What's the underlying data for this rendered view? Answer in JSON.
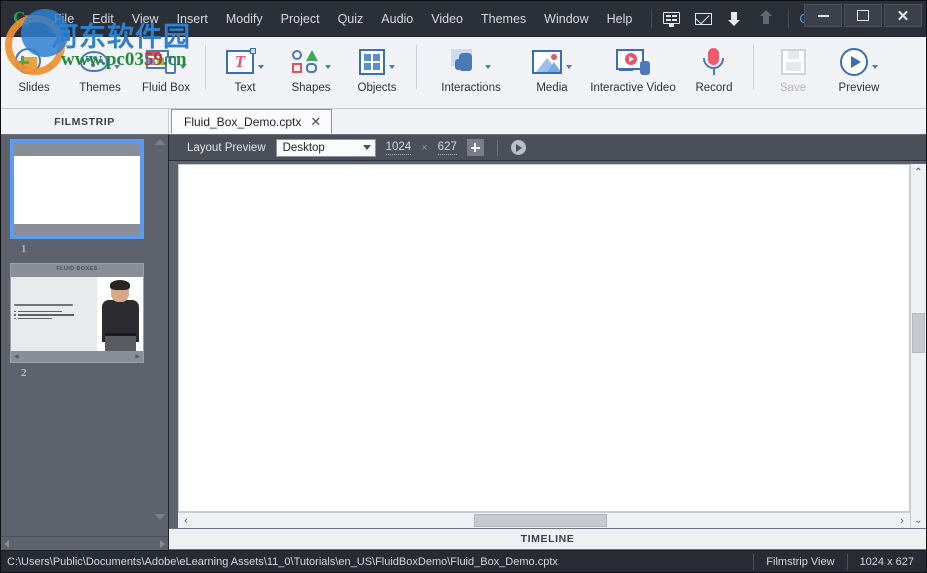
{
  "window": {
    "logo_text": "Cp",
    "workspace": "Classic",
    "controls": {
      "minimize": "–",
      "maximize": "□",
      "close": "✕"
    }
  },
  "menubar": {
    "items": [
      "File",
      "Edit",
      "View",
      "Insert",
      "Modify",
      "Project",
      "Quiz",
      "Audio",
      "Video",
      "Themes",
      "Window",
      "Help"
    ],
    "icons": [
      "monitor-icon",
      "mail-icon",
      "download-arrow-icon",
      "upload-arrow-icon"
    ]
  },
  "watermark": {
    "chinese": "河东软件园",
    "url_prefix": "www.pc03",
    "url_mid": "59",
    "url_suffix": ".cn"
  },
  "ribbon": {
    "groups": [
      {
        "items": [
          {
            "label": "Slides",
            "icon": "slides-icon",
            "caret": true,
            "disabled": false
          },
          {
            "label": "Themes",
            "icon": "themes-icon",
            "caret": true,
            "disabled": false
          },
          {
            "label": "Fluid Box",
            "icon": "fluid-box-icon",
            "caret": true,
            "disabled": false
          }
        ]
      },
      {
        "items": [
          {
            "label": "Text",
            "icon": "text-icon",
            "caret": true,
            "disabled": false
          },
          {
            "label": "Shapes",
            "icon": "shapes-icon",
            "caret": true,
            "disabled": false
          },
          {
            "label": "Objects",
            "icon": "objects-icon",
            "caret": true,
            "disabled": false
          }
        ]
      },
      {
        "items": [
          {
            "label": "Interactions",
            "icon": "interactions-icon",
            "caret": true,
            "disabled": false
          },
          {
            "label": "Media",
            "icon": "media-icon",
            "caret": true,
            "disabled": false
          },
          {
            "label": "Interactive Video",
            "icon": "interactive-video-icon",
            "caret": false,
            "disabled": false
          },
          {
            "label": "Record",
            "icon": "record-icon",
            "caret": false,
            "disabled": false
          }
        ]
      },
      {
        "items": [
          {
            "label": "Save",
            "icon": "save-icon",
            "caret": false,
            "disabled": true
          },
          {
            "label": "Preview",
            "icon": "preview-icon",
            "caret": true,
            "disabled": false
          }
        ]
      }
    ]
  },
  "tabs": {
    "filmstrip_label": "FILMSTRIP",
    "document": {
      "name": "Fluid_Box_Demo.cptx",
      "close": "✕"
    }
  },
  "filmstrip": {
    "slides": [
      {
        "number": "1",
        "selected": true,
        "title": "",
        "has_photo": false
      },
      {
        "number": "2",
        "selected": false,
        "title": "FLUID BOXES",
        "has_photo": true,
        "body_text": "Responsive authoring made easier and faster!",
        "bullets": [
          "Intelligent use of white space",
          "Device friendly content alignment",
          "Reclaim unused space"
        ]
      }
    ]
  },
  "layoutbar": {
    "label": "Layout Preview",
    "device": "Desktop",
    "width": "1024",
    "separator": "×",
    "height": "627",
    "add_button": "add-breakpoint-icon",
    "play_button": "preview-play-icon"
  },
  "timeline": {
    "label": "TIMELINE"
  },
  "statusbar": {
    "path": "C:\\Users\\Public\\Documents\\Adobe\\eLearning Assets\\11_0\\Tutorials\\en_US\\FluidBoxDemo\\Fluid_Box_Demo.cptx",
    "view_mode": "Filmstrip View",
    "dimensions": "1024 x 627"
  },
  "scrollbars": {
    "h_left": "‹",
    "h_right": "›",
    "v_up": "⌃",
    "v_down": "⌄",
    "fs_left": "◂",
    "fs_right": "▸"
  },
  "colors": {
    "chrome_dark": "#2b2f38",
    "ribbon_bg": "#f2f3f7",
    "panel_gray": "#5d626d",
    "accent_blue": "#5b9bf0",
    "icon_blue": "#4a78b8",
    "accent_red": "#ef5a6e"
  }
}
